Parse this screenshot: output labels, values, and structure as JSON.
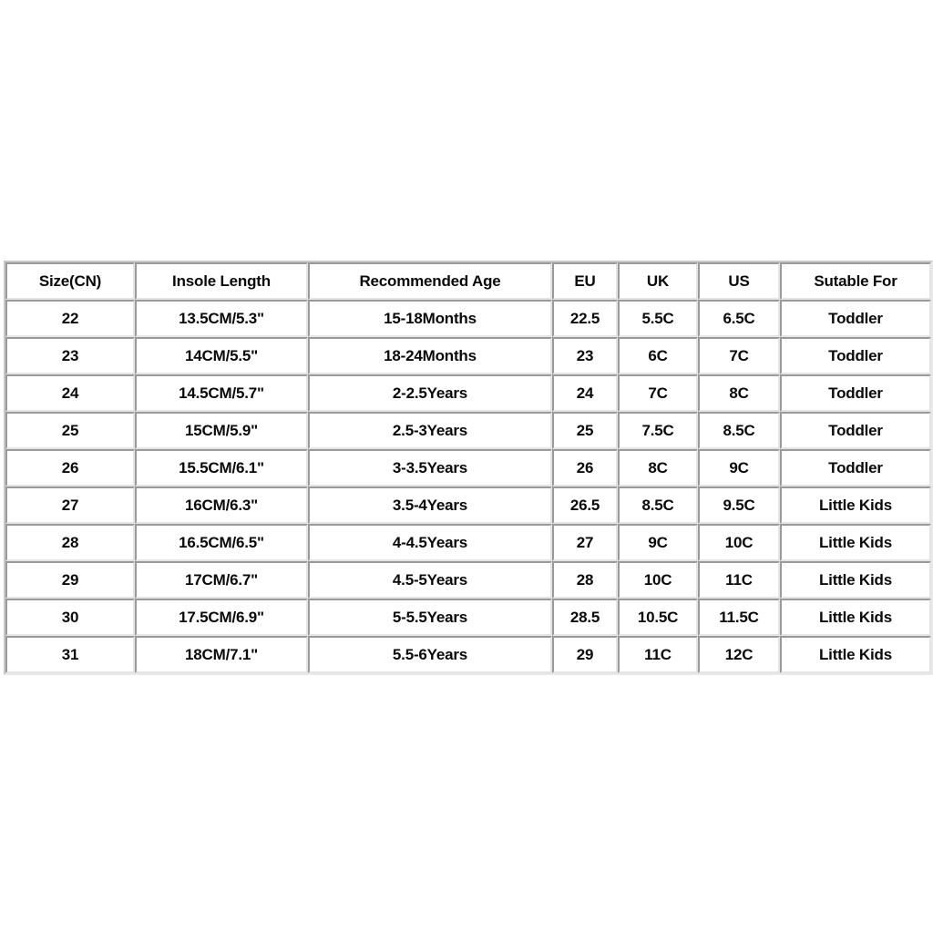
{
  "table": {
    "name": "shoe-size-chart",
    "columns": [
      {
        "key": "size_cn",
        "label": "Size(CN)"
      },
      {
        "key": "insole",
        "label": "Insole Length"
      },
      {
        "key": "age",
        "label": "Recommended Age"
      },
      {
        "key": "eu",
        "label": "EU"
      },
      {
        "key": "uk",
        "label": "UK"
      },
      {
        "key": "us",
        "label": "US"
      },
      {
        "key": "for",
        "label": "Sutable For"
      }
    ],
    "rows": [
      {
        "size_cn": "22",
        "insole": "13.5CM/5.3\"",
        "age": "15-18Months",
        "eu": "22.5",
        "uk": "5.5C",
        "us": "6.5C",
        "for": "Toddler"
      },
      {
        "size_cn": "23",
        "insole": "14CM/5.5\"",
        "age": "18-24Months",
        "eu": "23",
        "uk": "6C",
        "us": "7C",
        "for": "Toddler"
      },
      {
        "size_cn": "24",
        "insole": "14.5CM/5.7\"",
        "age": "2-2.5Years",
        "eu": "24",
        "uk": "7C",
        "us": "8C",
        "for": "Toddler"
      },
      {
        "size_cn": "25",
        "insole": "15CM/5.9\"",
        "age": "2.5-3Years",
        "eu": "25",
        "uk": "7.5C",
        "us": "8.5C",
        "for": "Toddler"
      },
      {
        "size_cn": "26",
        "insole": "15.5CM/6.1\"",
        "age": "3-3.5Years",
        "eu": "26",
        "uk": "8C",
        "us": "9C",
        "for": "Toddler"
      },
      {
        "size_cn": "27",
        "insole": "16CM/6.3\"",
        "age": "3.5-4Years",
        "eu": "26.5",
        "uk": "8.5C",
        "us": "9.5C",
        "for": "Little Kids"
      },
      {
        "size_cn": "28",
        "insole": "16.5CM/6.5\"",
        "age": "4-4.5Years",
        "eu": "27",
        "uk": "9C",
        "us": "10C",
        "for": "Little Kids"
      },
      {
        "size_cn": "29",
        "insole": "17CM/6.7\"",
        "age": "4.5-5Years",
        "eu": "28",
        "uk": "10C",
        "us": "11C",
        "for": "Little Kids"
      },
      {
        "size_cn": "30",
        "insole": "17.5CM/6.9\"",
        "age": "5-5.5Years",
        "eu": "28.5",
        "uk": "10.5C",
        "us": "11.5C",
        "for": "Little Kids"
      },
      {
        "size_cn": "31",
        "insole": "18CM/7.1\"",
        "age": "5.5-6Years",
        "eu": "29",
        "uk": "11C",
        "us": "12C",
        "for": "Little Kids"
      }
    ]
  },
  "colors": {
    "background": "#ffffff",
    "text": "#0a0a0a",
    "cell_border_dark": "#9a9a9a",
    "cell_border_light": "#e4e4e4"
  }
}
